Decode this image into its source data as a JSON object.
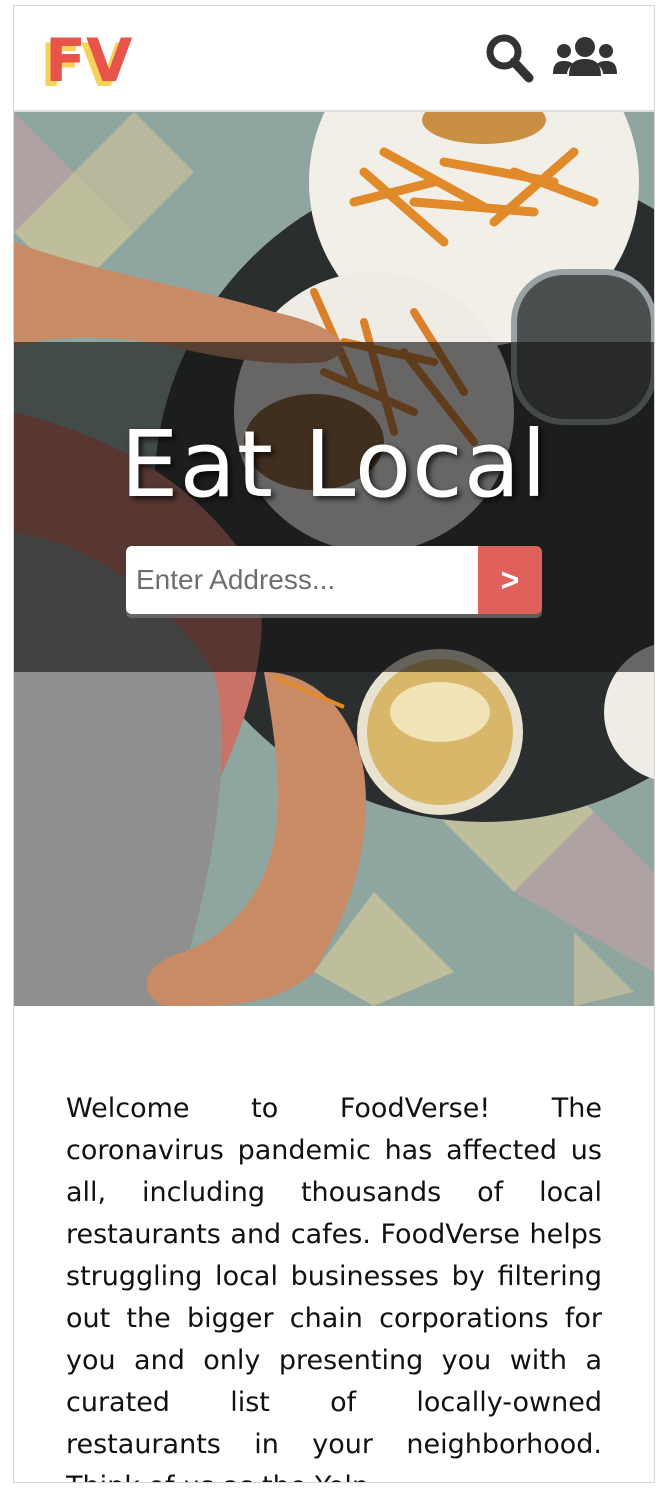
{
  "header": {
    "logo_text": "FV",
    "search_icon": "search-icon",
    "users_icon": "users-icon"
  },
  "hero": {
    "title": "Eat Local",
    "address_placeholder": "Enter Address...",
    "submit_label": ">"
  },
  "intro": {
    "text": "Welcome to FoodVerse! The coronavirus pandemic has affected us all, including thousands of local restaurants and cafes. FoodVerse helps struggling local businesses by filtering out the bigger chain corporations for you and only presenting you with a curated list of locally-owned restaurants in your neighborhood. Think of us as the Yelp"
  },
  "colors": {
    "accent_red": "#e0615c",
    "logo_red": "#e8534a",
    "logo_yellow": "#f7d25a",
    "icon_dark": "#333333"
  }
}
